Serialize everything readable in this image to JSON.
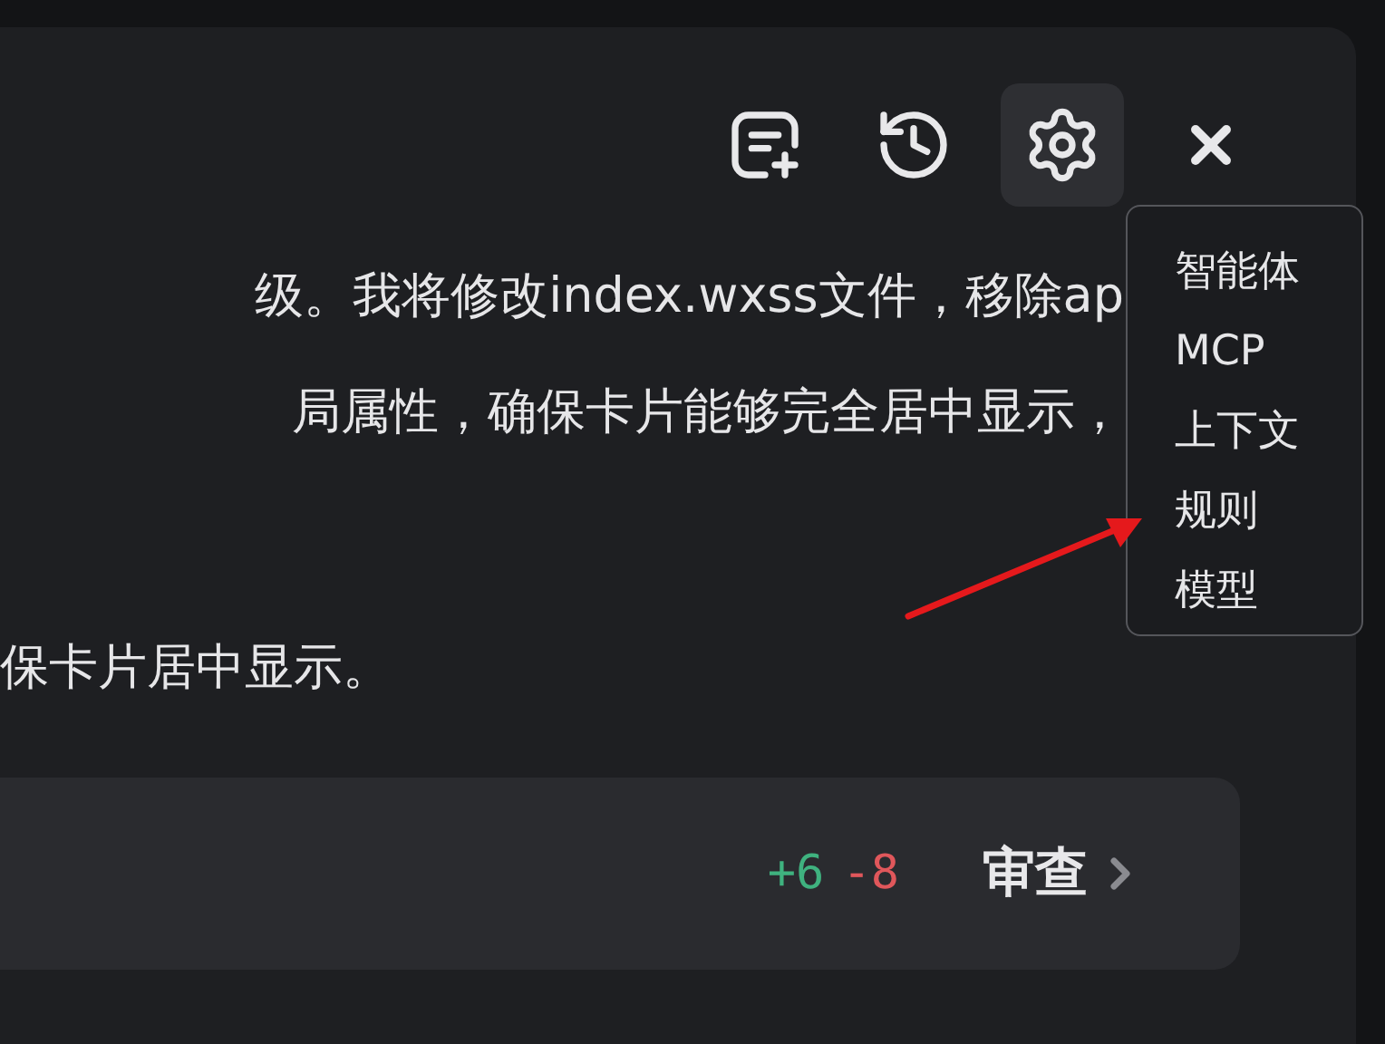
{
  "toolbar": {
    "buttons": [
      {
        "kind": "new-chat",
        "selected": false
      },
      {
        "kind": "history",
        "selected": false
      },
      {
        "kind": "settings",
        "selected": true
      },
      {
        "kind": "close",
        "selected": false
      }
    ]
  },
  "menu": {
    "items": [
      "智能体",
      "MCP",
      "上下文",
      "规则",
      "模型"
    ]
  },
  "message": {
    "lines": [
      "级。我将修改index.wxss文件，移除ap",
      "局属性，确保卡片能够完全居中显示，"
    ],
    "closing": "保卡片居中显示。"
  },
  "change_card": {
    "added": "+6",
    "removed": "-8",
    "action": "审查"
  }
}
